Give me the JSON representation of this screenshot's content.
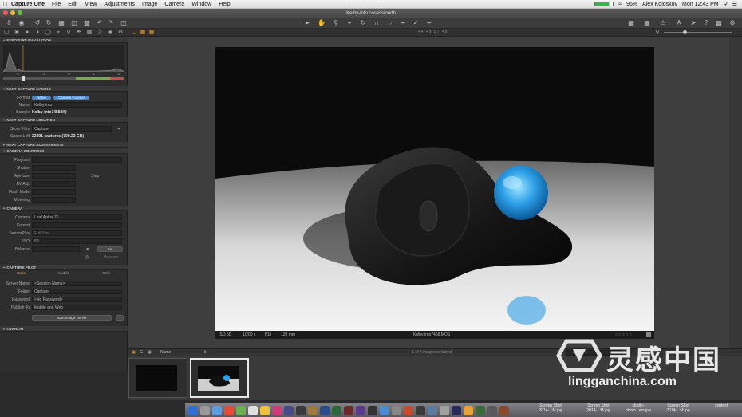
{
  "menubar": {
    "app_name": "Capture One",
    "items": [
      "File",
      "Edit",
      "View",
      "Adjustments",
      "Image",
      "Camera",
      "Window",
      "Help"
    ],
    "battery": "96%",
    "user": "Alex Koloskov",
    "clock": "Mon 12:43 PM"
  },
  "window": {
    "title": "Kelby-into.cosessiondb"
  },
  "zoom_marks": "44  49  57  48",
  "left_panel": {
    "exposure_evaluation": {
      "header": "EXPOSURE EVALUATION",
      "scale": [
        "-2",
        "-1",
        "0",
        "1",
        "2"
      ]
    },
    "next_capture_naming": {
      "header": "NEXT CAPTURE NAMING",
      "format_label": "Format",
      "format_tokens": [
        "Name",
        "Camera Counter"
      ],
      "name_label": "Name",
      "name_value": "Kelby-into",
      "sample_label": "Sample",
      "sample_value": "Kelby-into7458.IIQ"
    },
    "next_capture_location": {
      "header": "NEXT CAPTURE LOCATION",
      "store_label": "Store Files",
      "store_value": "Capture",
      "space_label": "Space Left",
      "space_value": "22491 captures (709.23 GB)"
    },
    "next_capture_adjustments": {
      "header": "NEXT CAPTURE ADJUSTMENTS"
    },
    "camera_controls": {
      "header": "CAMERA CONTROLS",
      "rows": [
        "Program",
        "Shutter",
        "Aperture",
        "EV Adj.",
        "Flash Mode",
        "Metering"
      ],
      "step_label": "Step"
    },
    "camera": {
      "header": "CAMERA",
      "camera_label": "Camera",
      "camera_value": "Leaf Aptus 75",
      "format_label": "Format",
      "sensorplus_label": "SensorPlus",
      "sensorplus_value": "Full Size",
      "iso_label": "ISO",
      "iso_value": "50",
      "balance_label": "Balance",
      "set_button": "Set",
      "preview_label": "Preview"
    },
    "capture_pilot": {
      "header": "CAPTURE PILOT",
      "tabs": [
        "Basic",
        "Mobile",
        "Web"
      ],
      "server_name_label": "Server Name",
      "server_name_value": "<Session Name>",
      "folder_label": "Folder",
      "folder_value": "Capture",
      "password_label": "Password",
      "password_value": "<No Password>",
      "publish_label": "Publish To",
      "publish_value": "Mobile and Web",
      "start_button": "Start Image Server"
    },
    "overlay": {
      "header": "OVERLAY"
    }
  },
  "viewer": {
    "info_iso": "ISO 50",
    "info_shutter": "1/200 s",
    "info_aperture": "f/16",
    "info_focal": "120 mm",
    "filename": "Kelby-into7458.MOS"
  },
  "browser": {
    "sort_label": "Name",
    "status": "1 of 2 images selected",
    "search_placeholder": "Search"
  },
  "dock": {
    "labels": [
      "Screen Shot 2014-...M.jpg",
      "Screen Shot 2014-...M.jpg",
      "studio-photo...ers.jpg",
      "Screen Shot 2014-...M.jpg",
      "context"
    ]
  },
  "watermark": {
    "chinese": "灵感中国",
    "url": "lingganchina.com"
  }
}
